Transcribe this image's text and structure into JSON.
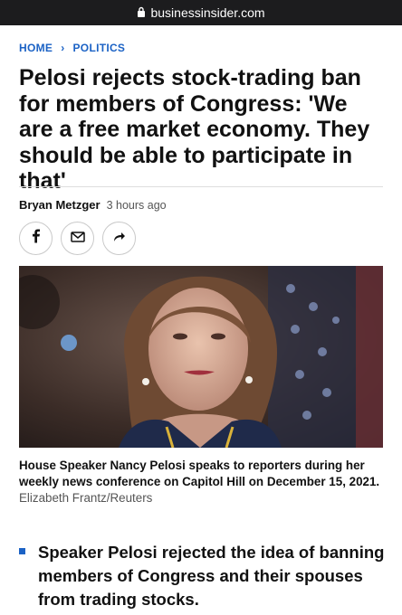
{
  "browser": {
    "url": "businessinsider.com"
  },
  "breadcrumb": {
    "home": "HOME",
    "separator": "›",
    "section": "POLITICS"
  },
  "article": {
    "headline": "Pelosi rejects stock-trading ban for members of Congress: 'We are a free market economy. They should be able to participate in that'",
    "author": "Bryan Metzger",
    "time": "3 hours ago",
    "share_icons": [
      "facebook-icon",
      "email-icon",
      "share-arrow-icon"
    ],
    "caption": "House Speaker Nancy Pelosi speaks to reporters during her weekly news conference on Capitol Hill on December 15, 2021.",
    "photo_credit": "Elizabeth Frantz/Reuters",
    "bullets": [
      "Speaker Pelosi rejected the idea of banning members of Congress and their spouses from trading stocks."
    ]
  },
  "colors": {
    "accent": "#1b62c5",
    "urlbar": "#1c1c1e"
  }
}
